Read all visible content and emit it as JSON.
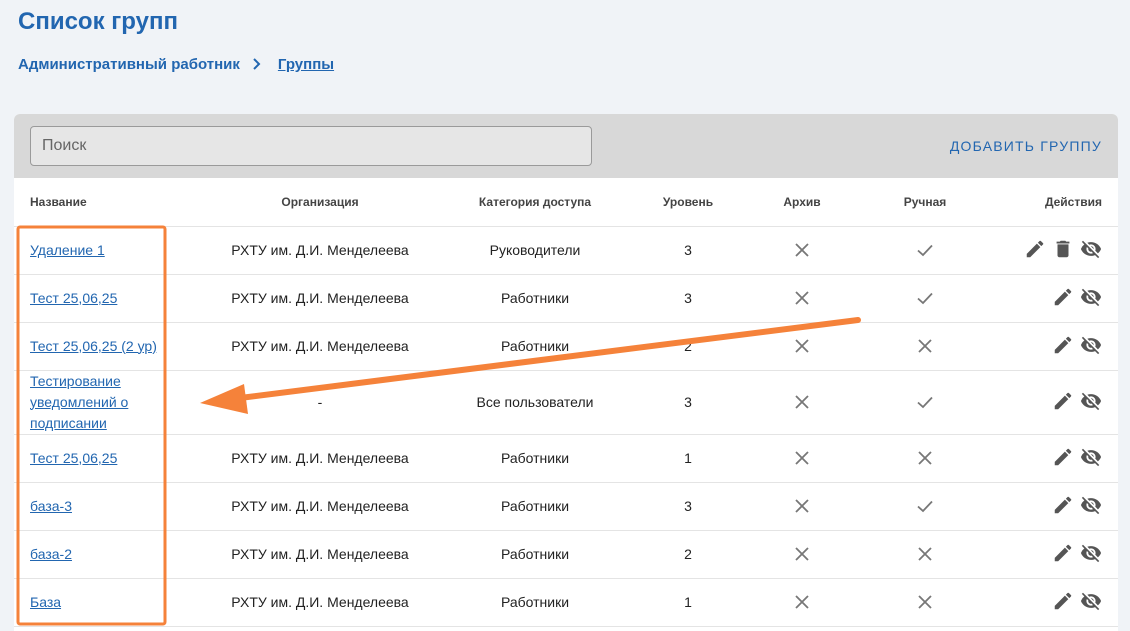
{
  "page": {
    "title": "Список групп"
  },
  "breadcrumb": {
    "items": [
      "Административный работник",
      "Группы"
    ]
  },
  "toolbar": {
    "search_placeholder": "Поиск",
    "add_button": "ДОБАВИТЬ ГРУППУ"
  },
  "table": {
    "columns": [
      "Название",
      "Организация",
      "Категория доступа",
      "Уровень",
      "Архив",
      "Ручная",
      "Действия"
    ],
    "rows": [
      {
        "name": "Удаление 1",
        "org": "РХТУ им. Д.И. Менделеева",
        "category": "Руководители",
        "level": "3",
        "archive": false,
        "manual": true,
        "actions": [
          "edit",
          "delete",
          "hide"
        ]
      },
      {
        "name": "Тест 25,06,25",
        "org": "РХТУ им. Д.И. Менделеева",
        "category": "Работники",
        "level": "3",
        "archive": false,
        "manual": true,
        "actions": [
          "edit",
          "hide"
        ]
      },
      {
        "name": "Тест 25,06,25 (2 ур)",
        "org": "РХТУ им. Д.И. Менделеева",
        "category": "Работники",
        "level": "2",
        "archive": false,
        "manual": false,
        "actions": [
          "edit",
          "hide"
        ]
      },
      {
        "name": "Тестирование уведомлений о подписании",
        "org": "-",
        "category": "Все пользователи",
        "level": "3",
        "archive": false,
        "manual": true,
        "actions": [
          "edit",
          "hide"
        ]
      },
      {
        "name": "Тест 25,06,25",
        "org": "РХТУ им. Д.И. Менделеева",
        "category": "Работники",
        "level": "1",
        "archive": false,
        "manual": false,
        "actions": [
          "edit",
          "hide"
        ]
      },
      {
        "name": "база-3",
        "org": "РХТУ им. Д.И. Менделеева",
        "category": "Работники",
        "level": "3",
        "archive": false,
        "manual": true,
        "actions": [
          "edit",
          "hide"
        ]
      },
      {
        "name": "база-2",
        "org": "РХТУ им. Д.И. Менделеева",
        "category": "Работники",
        "level": "2",
        "archive": false,
        "manual": false,
        "actions": [
          "edit",
          "hide"
        ]
      },
      {
        "name": "База",
        "org": "РХТУ им. Д.И. Менделеева",
        "category": "Работники",
        "level": "1",
        "archive": false,
        "manual": false,
        "actions": [
          "edit",
          "hide"
        ]
      }
    ]
  },
  "annotation": {
    "color": "#f5823a"
  },
  "colors": {
    "accent": "#2266b0",
    "icon": "#555555",
    "mark": "#777777"
  }
}
